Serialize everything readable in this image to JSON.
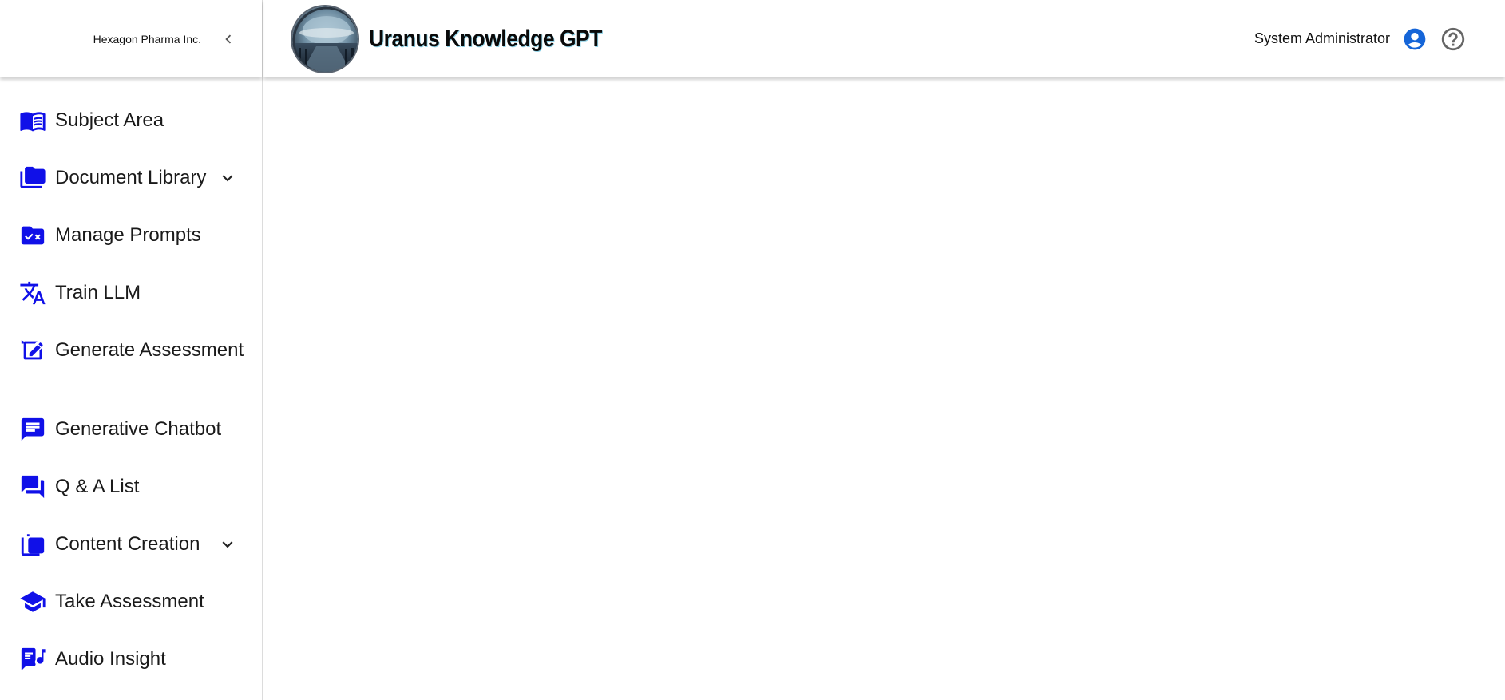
{
  "org": {
    "name": "Hexagon Pharma Inc."
  },
  "app": {
    "title": "Uranus Knowledge GPT"
  },
  "user": {
    "name": "System Administrator"
  },
  "colors": {
    "icon_accent": "#1010e8",
    "account_icon": "#1565d8",
    "help_icon": "#666666"
  },
  "sidebar": {
    "groups": [
      {
        "items": [
          {
            "label": "Subject Area",
            "icon": "menu-book-icon",
            "expandable": false
          },
          {
            "label": "Document Library",
            "icon": "folder-icon",
            "expandable": true
          },
          {
            "label": "Manage Prompts",
            "icon": "rule-folder-icon",
            "expandable": false
          },
          {
            "label": "Train LLM",
            "icon": "translate-icon",
            "expandable": false
          },
          {
            "label": "Generate Assessment",
            "icon": "edit-note-icon",
            "expandable": false
          }
        ]
      },
      {
        "items": [
          {
            "label": "Generative Chatbot",
            "icon": "chat-icon",
            "expandable": false
          },
          {
            "label": "Q & A List",
            "icon": "forum-icon",
            "expandable": false
          },
          {
            "label": "Content Creation",
            "icon": "library-icon",
            "expandable": true
          },
          {
            "label": "Take Assessment",
            "icon": "school-icon",
            "expandable": false
          },
          {
            "label": "Audio Insight",
            "icon": "lyrics-icon",
            "expandable": false
          }
        ]
      }
    ]
  }
}
